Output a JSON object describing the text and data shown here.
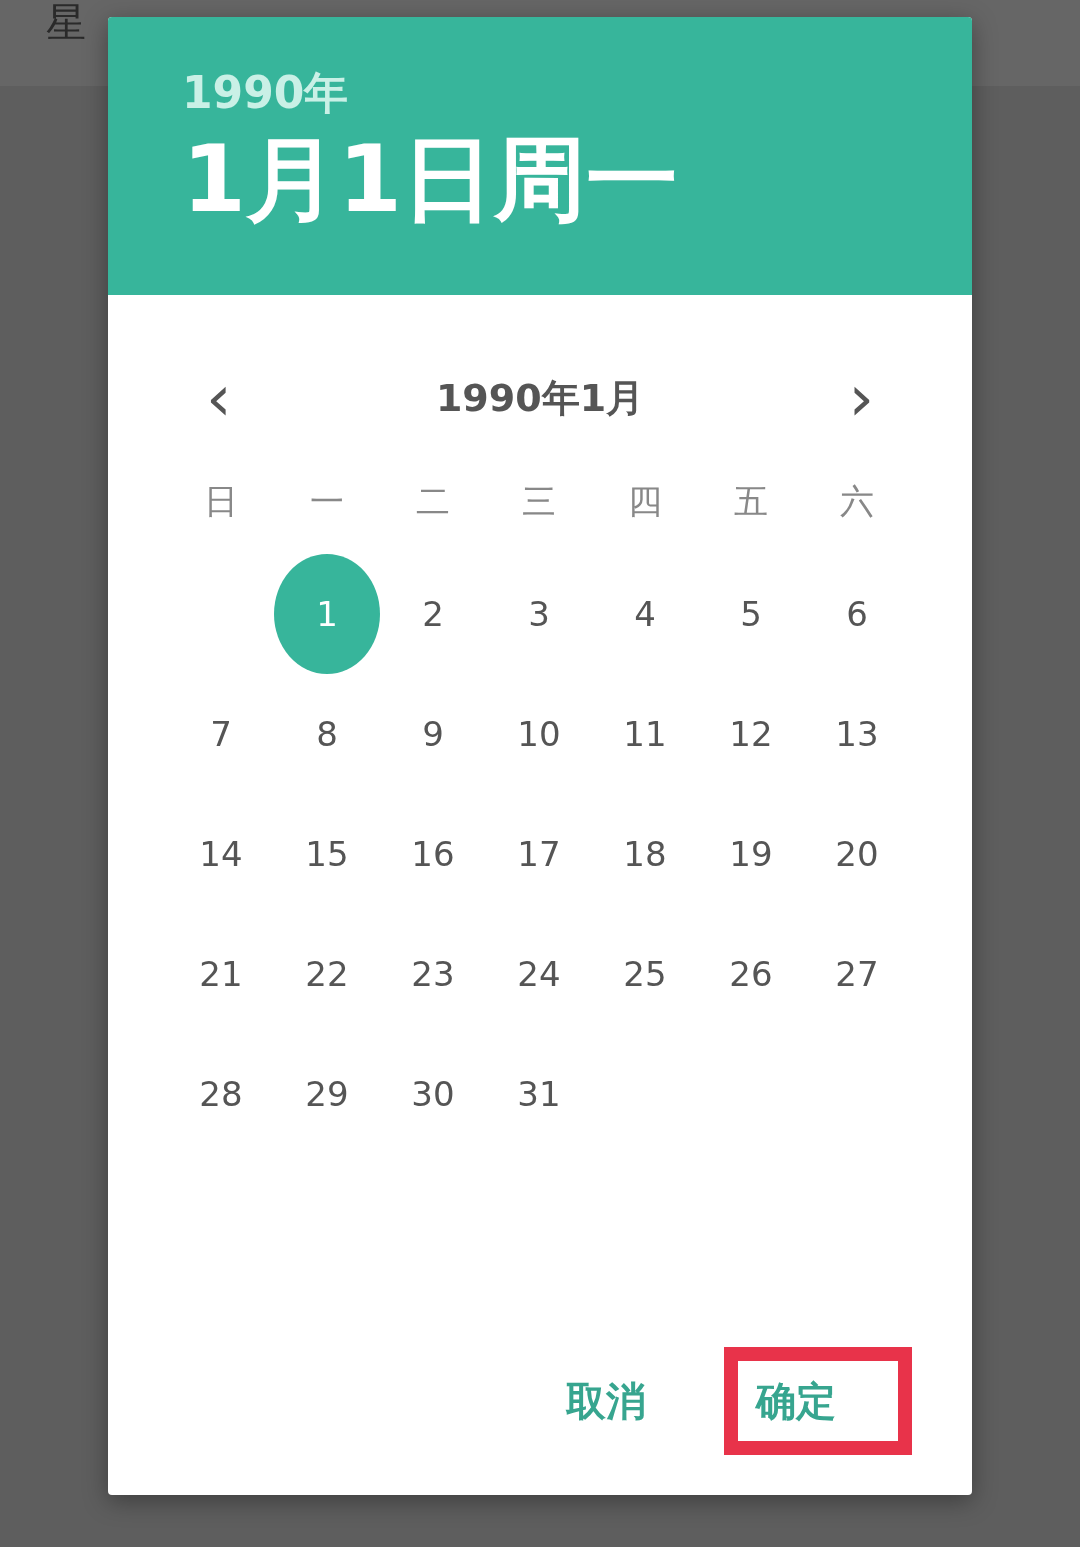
{
  "background": {
    "label": "星"
  },
  "header": {
    "year": "1990年",
    "date": "1月1日周一"
  },
  "month_nav": {
    "prev": "‹",
    "title": "1990年1月",
    "next": "›"
  },
  "weekdays": [
    "日",
    "一",
    "二",
    "三",
    "四",
    "五",
    "六"
  ],
  "weeks": [
    {
      "days": [
        {
          "day": "1",
          "selected": true
        },
        {
          "day": "2",
          "selected": false
        },
        {
          "day": "3",
          "selected": false
        },
        {
          "day": "4",
          "selected": false
        },
        {
          "day": "5",
          "selected": false
        },
        {
          "day": "6",
          "selected": false
        }
      ]
    },
    {
      "days": [
        {
          "day": "7",
          "selected": false
        },
        {
          "day": "8",
          "selected": false
        },
        {
          "day": "9",
          "selected": false
        },
        {
          "day": "10",
          "selected": false
        },
        {
          "day": "11",
          "selected": false
        },
        {
          "day": "12",
          "selected": false
        },
        {
          "day": "13",
          "selected": false
        }
      ]
    },
    {
      "days": [
        {
          "day": "14",
          "selected": false
        },
        {
          "day": "15",
          "selected": false
        },
        {
          "day": "16",
          "selected": false
        },
        {
          "day": "17",
          "selected": false
        },
        {
          "day": "18",
          "selected": false
        },
        {
          "day": "19",
          "selected": false
        },
        {
          "day": "20",
          "selected": false
        }
      ]
    },
    {
      "days": [
        {
          "day": "21",
          "selected": false
        },
        {
          "day": "22",
          "selected": false
        },
        {
          "day": "23",
          "selected": false
        },
        {
          "day": "24",
          "selected": false
        },
        {
          "day": "25",
          "selected": false
        },
        {
          "day": "26",
          "selected": false
        },
        {
          "day": "27",
          "selected": false
        }
      ]
    },
    {
      "days": [
        {
          "day": "28",
          "selected": false
        },
        {
          "day": "29",
          "selected": false
        },
        {
          "day": "30",
          "selected": false
        },
        {
          "day": "31",
          "selected": false
        }
      ]
    }
  ],
  "buttons": [
    {
      "label": "取消",
      "highlighted": false
    },
    {
      "label": "确定",
      "highlighted": true
    }
  ]
}
